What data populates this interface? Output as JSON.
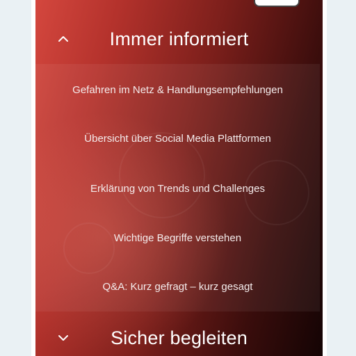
{
  "sections": [
    {
      "title": "Immer informiert",
      "expanded": true,
      "toggle_icon": "chevron-up-icon",
      "items": [
        {
          "label": "Gefahren im Netz & Handlungsempfehlungen"
        },
        {
          "label": "Übersicht über Social Media Plattformen"
        },
        {
          "label": "Erklärung von Trends und Challenges"
        },
        {
          "label": "Wichtige Begriffe verstehen"
        },
        {
          "label": "Q&A: Kurz gefragt – kurz gesagt"
        }
      ]
    },
    {
      "title": "Sicher begleiten",
      "expanded": false,
      "toggle_icon": "chevron-down-icon",
      "items": []
    }
  ],
  "colors": {
    "background_start": "#d4473e",
    "background_end": "#140404",
    "text": "#ffffff"
  }
}
